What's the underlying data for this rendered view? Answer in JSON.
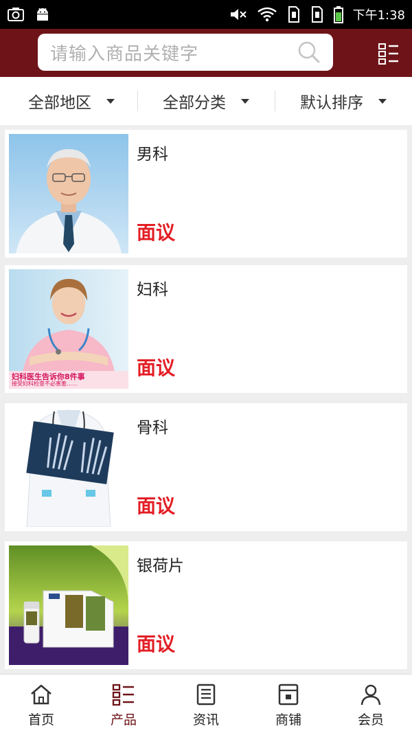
{
  "status_bar": {
    "time": "下午1:38",
    "icons": [
      "camera-icon",
      "android-icon",
      "mute-icon",
      "wifi-icon",
      "sim1-icon",
      "sim2-icon",
      "battery-icon"
    ]
  },
  "header": {
    "search_placeholder": "请输入商品关键字",
    "search_icon": "search-icon",
    "menu_icon": "list-menu-icon",
    "bg_color": "#6e1418"
  },
  "filters": [
    {
      "label": "全部地区"
    },
    {
      "label": "全部分类"
    },
    {
      "label": "默认排序"
    }
  ],
  "products": [
    {
      "name": "男科",
      "price": "面议",
      "image": "elderly-doctor-photo"
    },
    {
      "name": "妇科",
      "price": "面议",
      "image": "nurse-photo",
      "image_caption_1": "妇科医生告诉你8件事",
      "image_caption_2": "接受妇科检查不必害羞……"
    },
    {
      "name": "骨科",
      "price": "面议",
      "image": "doctor-xray-photo"
    },
    {
      "name": "银荷片",
      "price": "面议",
      "image": "medicine-box-photo"
    }
  ],
  "price_color": "#e31e25",
  "bottom_nav": [
    {
      "label": "首页",
      "icon": "home-icon",
      "active": false
    },
    {
      "label": "产品",
      "icon": "product-list-icon",
      "active": true
    },
    {
      "label": "资讯",
      "icon": "news-icon",
      "active": false
    },
    {
      "label": "商铺",
      "icon": "shop-icon",
      "active": false
    },
    {
      "label": "会员",
      "icon": "member-icon",
      "active": false
    }
  ]
}
